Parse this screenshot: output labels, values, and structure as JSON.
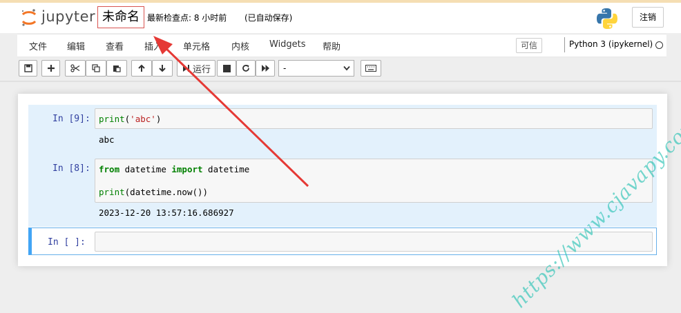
{
  "header": {
    "logo_text": "jupyter",
    "notebook_name": "未命名",
    "checkpoint": "最新检查点: 8 小时前",
    "autosave": "(已自动保存)",
    "logout_label": "注销"
  },
  "menubar": {
    "items": [
      "文件",
      "编辑",
      "查看",
      "插入",
      "单元格",
      "内核",
      "Widgets",
      "帮助"
    ],
    "trusted_label": "可信",
    "kernel_name": "Python 3 (ipykernel)"
  },
  "toolbar": {
    "run_label": "运行",
    "cell_type_value": "-"
  },
  "cells": [
    {
      "prompt": "In  [9]:",
      "code": [
        "print('abc')"
      ],
      "output": "abc"
    },
    {
      "prompt": "In  [8]:",
      "code": [
        "from datetime import datetime",
        "print(datetime.now())"
      ],
      "output": "2023-12-20 13:57:16.686927"
    },
    {
      "prompt": "In  [ ]:",
      "code": [],
      "output": ""
    }
  ],
  "watermark": "https://www.cjavapy.com",
  "colors": {
    "accent_orange": "#f37626",
    "annotation_red": "#e53935",
    "selected_cell_bg": "#e3f1fc",
    "edit_border": "#42a5f5",
    "watermark": "#2ec4b6"
  }
}
